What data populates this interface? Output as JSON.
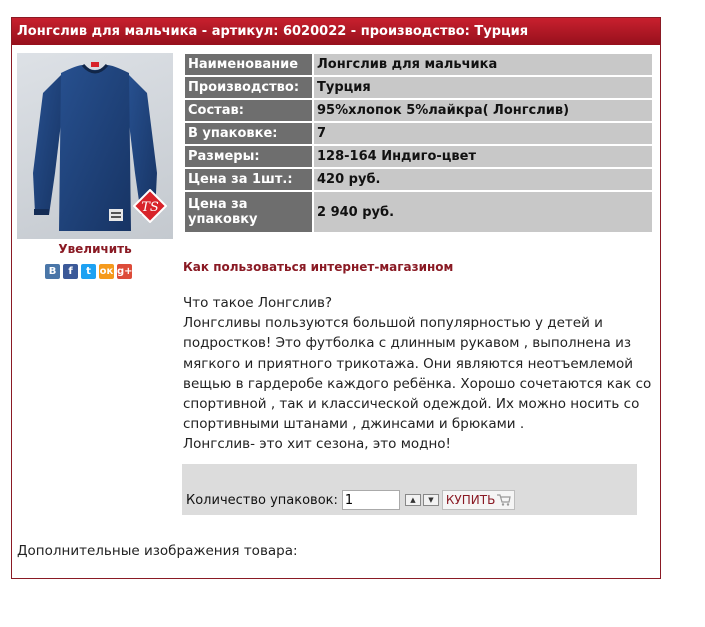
{
  "header": {
    "title": "Лонгслив для мальчика - артикул: 6020022 - производство: Турция"
  },
  "photo": {
    "zoom_label": "Увеличить",
    "brand_badge": "TS"
  },
  "share": [
    {
      "label": "В",
      "icon": "vkontakte-icon",
      "color": "#4a76a8"
    },
    {
      "label": "f",
      "icon": "facebook-icon",
      "color": "#3b5998"
    },
    {
      "label": "t",
      "icon": "twitter-icon",
      "color": "#1da1f2"
    },
    {
      "label": "ок",
      "icon": "odnoklassniki-icon",
      "color": "#f59a1c"
    },
    {
      "label": "g+",
      "icon": "google-plus-icon",
      "color": "#dd4b39"
    }
  ],
  "specs": [
    {
      "key": "Наименование",
      "value": "Лонгслив для мальчика"
    },
    {
      "key": "Производство:",
      "value": "Турция"
    },
    {
      "key": "Состав:",
      "value": "95%хлопок 5%лайкра( Лонгслив)"
    },
    {
      "key": "В упаковке:",
      "value": "7"
    },
    {
      "key": "Размеры:",
      "value": "128-164 Индиго-цвет"
    },
    {
      "key": "Цена за 1шт.:",
      "value": "420 руб."
    },
    {
      "key": "Цена за упаковку",
      "value": "2 940 руб."
    }
  ],
  "help_link": "Как пользоваться интернет-магазином",
  "description": [
    "Что такое Лонгслив?",
    "Лонгсливы пользуются большой популярностью у детей и подростков! Это футболка с длинным рукавом , выполнена из мягкого и приятного трикотажа. Они являются неотъемлемой вещью в гардеробе каждого ребёнка. Хорошо сочетаются как со спортивной , так и классической одеждой. Их можно носить со спортивными штанами , джинсами и брюками .",
    "Лонгслив- это хит сезона, это модно!"
  ],
  "order": {
    "qty_label": "Количество упаковок:",
    "qty_value": "1",
    "buy_label": "КУПИТЬ"
  },
  "extra_images_label": "Дополнительные изображения товара:",
  "colors": {
    "accent": "#8a1a24",
    "header_top": "#c8202e",
    "header_bottom": "#96101c",
    "shirt": "#1f3f73",
    "spec_key_bg": "#6e6e6e",
    "spec_value_bg": "#c8c8c8",
    "order_bg": "#dcdcdc"
  }
}
